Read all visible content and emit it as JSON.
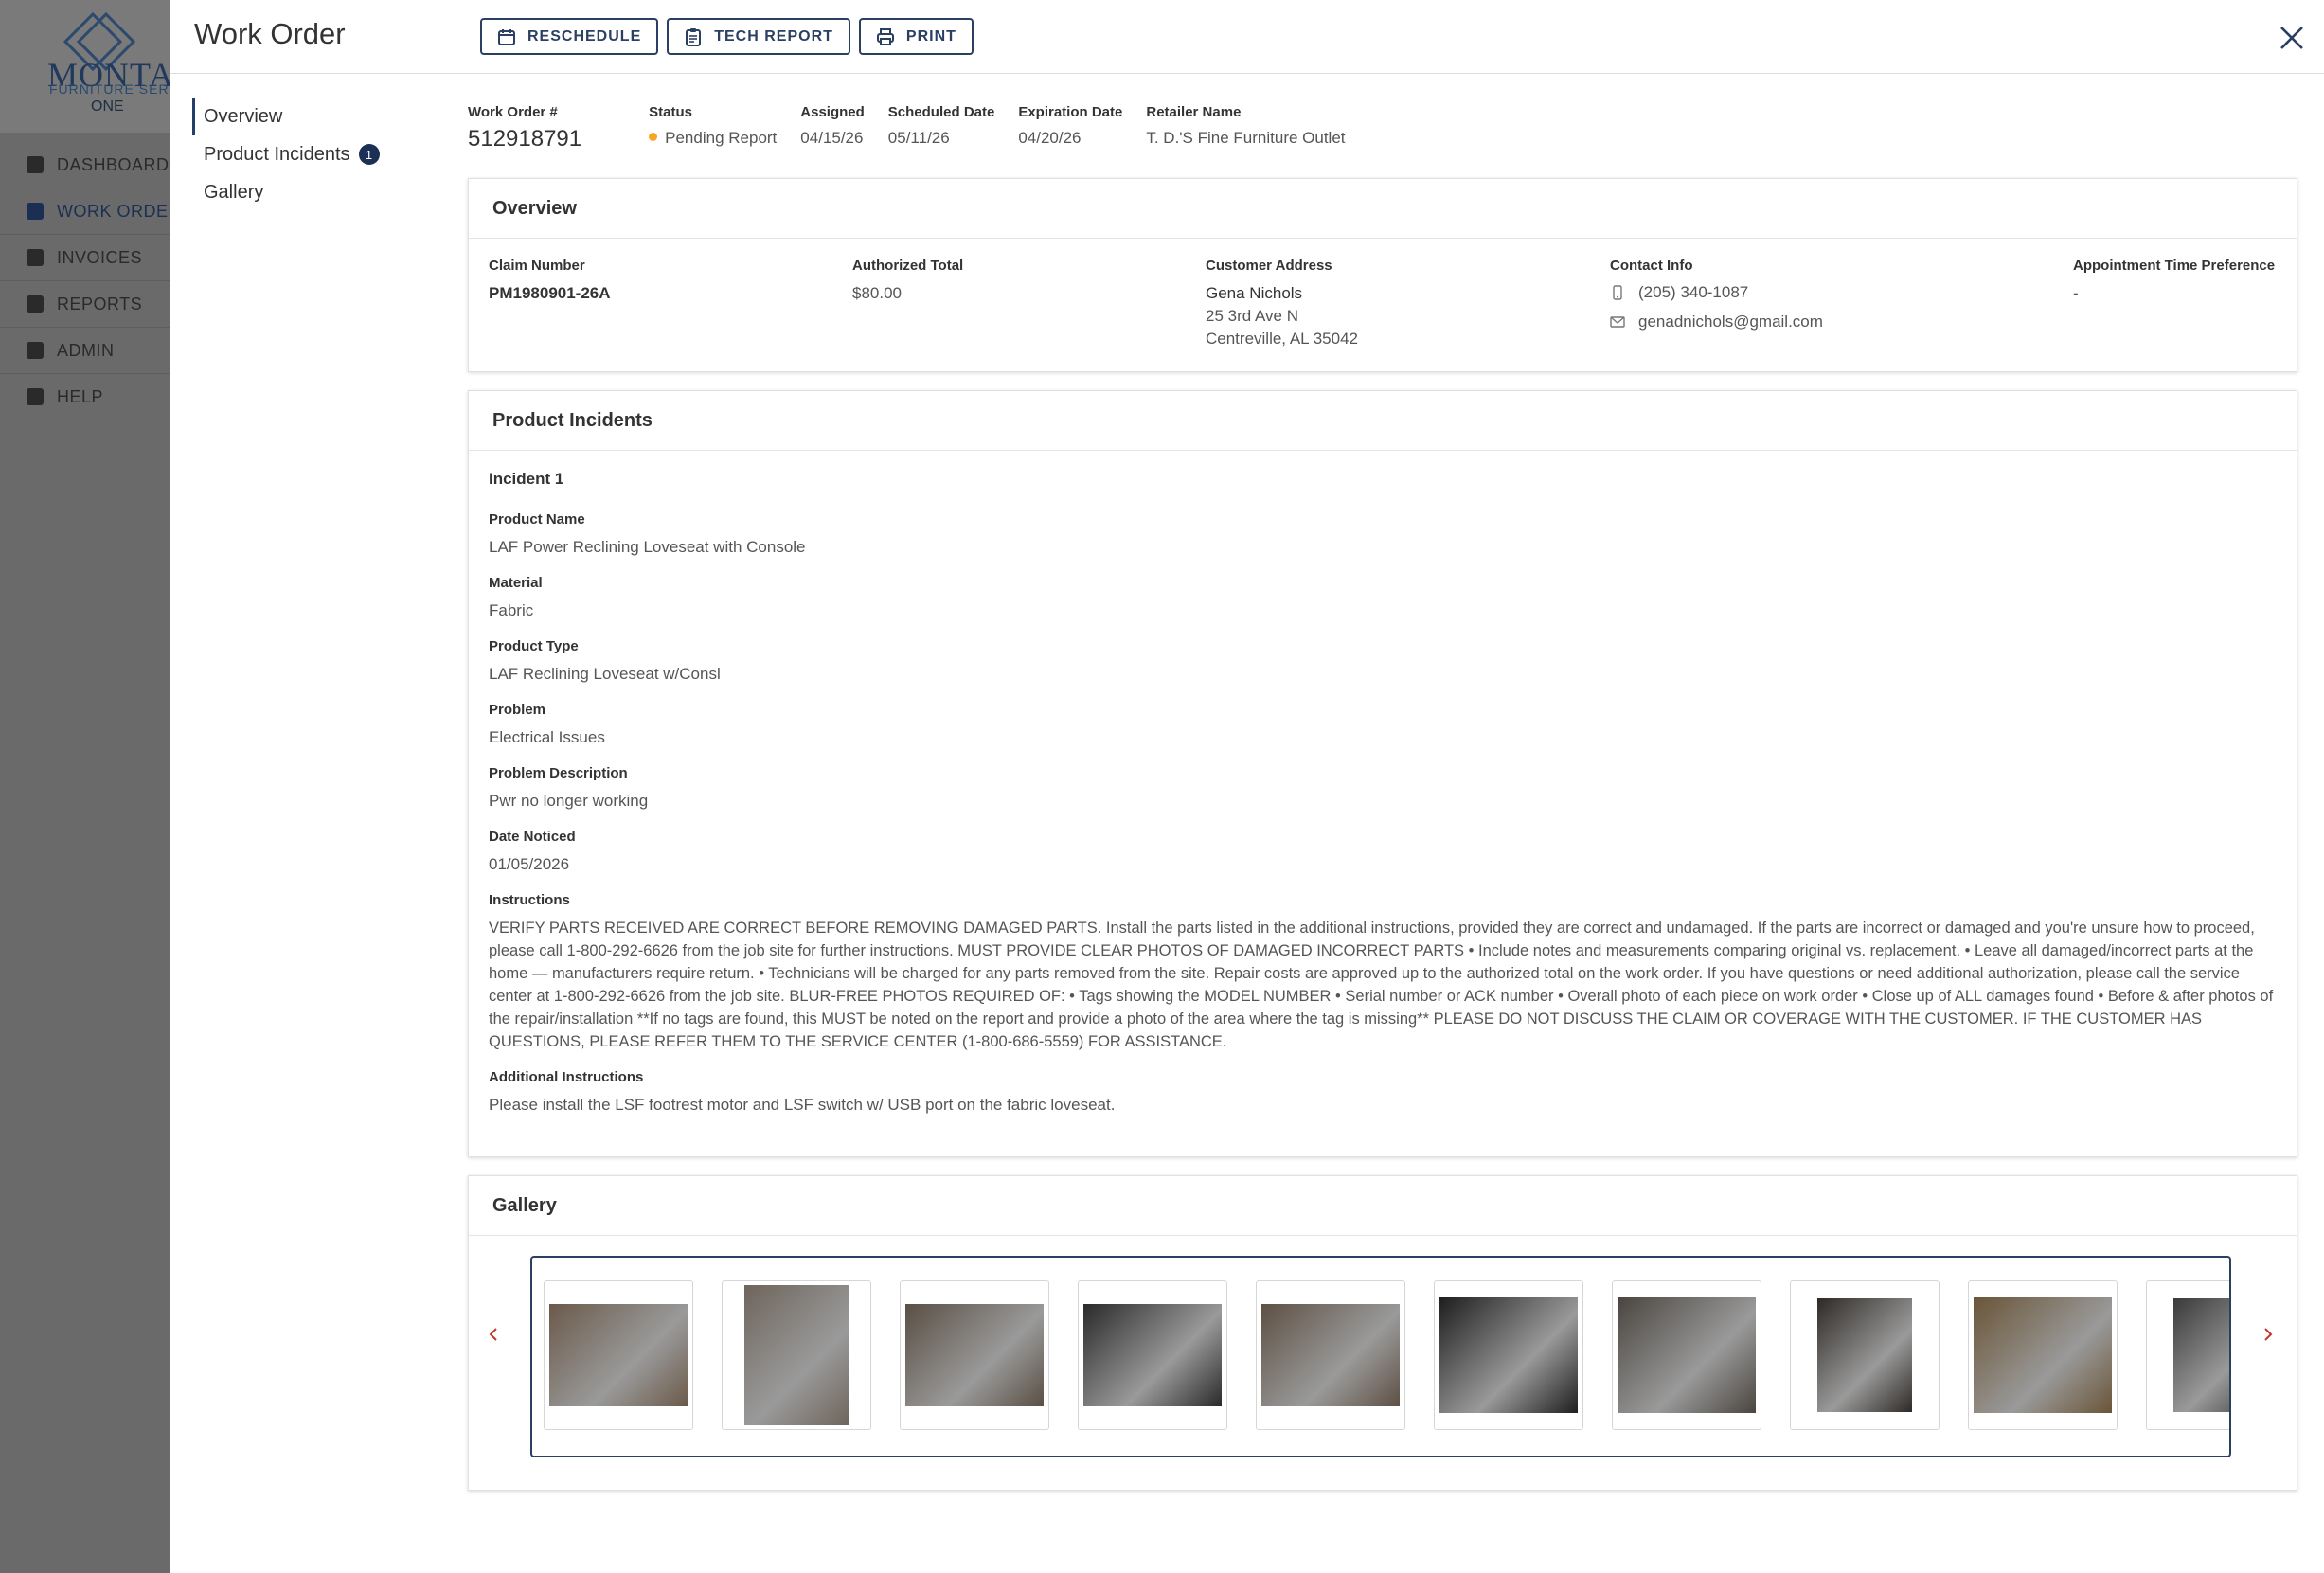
{
  "app": {
    "logo": {
      "name": "MONTAG",
      "sub": "FURNITURE SERV",
      "sub2": "ONE"
    },
    "nav": [
      {
        "label": "DASHBOARD"
      },
      {
        "label": "WORK ORDERS"
      },
      {
        "label": "INVOICES"
      },
      {
        "label": "REPORTS"
      },
      {
        "label": "ADMIN"
      },
      {
        "label": "HELP"
      }
    ]
  },
  "modal": {
    "title": "Work Order",
    "toolbar": {
      "reschedule": "RESCHEDULE",
      "tech_report": "TECH REPORT",
      "print": "PRINT"
    }
  },
  "section_nav": {
    "overview": "Overview",
    "product_incidents": "Product Incidents",
    "product_incidents_count": "1",
    "gallery": "Gallery"
  },
  "summary": {
    "work_order_label": "Work Order #",
    "work_order_value": "512918791",
    "status_label": "Status",
    "status_value": "Pending Report",
    "status_color": "#f5a623",
    "assigned_label": "Assigned",
    "assigned_value": "04/15/26",
    "scheduled_label": "Scheduled Date",
    "scheduled_value": "05/11/26",
    "expiration_label": "Expiration Date",
    "expiration_value": "04/20/26",
    "retailer_label": "Retailer Name",
    "retailer_value": "T. D.'S Fine Furniture Outlet"
  },
  "overview": {
    "heading": "Overview",
    "claim_label": "Claim Number",
    "claim_value": "PM1980901-26A",
    "total_label": "Authorized Total",
    "total_value": "$80.00",
    "address_label": "Customer Address",
    "customer_name": "Gena Nichols",
    "address_line1": "25 3rd Ave N",
    "address_line2": "Centreville, AL 35042",
    "contact_label": "Contact Info",
    "phone": "(205) 340-1087",
    "email": "genadnichols@gmail.com",
    "appt_label": "Appointment Time Preference",
    "appt_value": "-"
  },
  "incidents": {
    "heading": "Product Incidents",
    "incident_title": "Incident 1",
    "product_name_label": "Product Name",
    "product_name": "LAF Power Reclining Loveseat with Console",
    "material_label": "Material",
    "material": "Fabric",
    "product_type_label": "Product Type",
    "product_type": "LAF Reclining Loveseat w/Consl",
    "problem_label": "Problem",
    "problem": "Electrical Issues",
    "problem_desc_label": "Problem Description",
    "problem_desc": "Pwr no longer working",
    "date_noticed_label": "Date Noticed",
    "date_noticed": "01/05/2026",
    "instructions_label": "Instructions",
    "instructions": "VERIFY PARTS RECEIVED ARE CORRECT BEFORE REMOVING DAMAGED PARTS. Install the parts listed in the additional instructions, provided they are correct and undamaged. If the parts are incorrect or damaged and you're unsure how to proceed, please call 1-800-292-6626 from the job site for further instructions. MUST PROVIDE CLEAR PHOTOS OF DAMAGED INCORRECT PARTS • Include notes and measurements comparing original vs. replacement. • Leave all damaged/incorrect parts at the home — manufacturers require return. • Technicians will be charged for any parts removed from the site. Repair costs are approved up to the authorized total on the work order. If you have questions or need additional authorization, please call the service center at 1-800-292-6626 from the job site. BLUR-FREE PHOTOS REQUIRED OF: • Tags showing the MODEL NUMBER • Serial number or ACK number • Overall photo of each piece on work order • Close up of ALL damages found • Before & after photos of the repair/installation **If no tags are found, this MUST be noted on the report and provide a photo of the area where the tag is missing** PLEASE DO NOT DISCUSS THE CLAIM OR COVERAGE WITH THE CUSTOMER. IF THE CUSTOMER HAS QUESTIONS, PLEASE REFER THEM TO THE SERVICE CENTER (1-800-686-5559) FOR ASSISTANCE.",
    "additional_label": "Additional Instructions",
    "additional": "Please install the LSF footrest motor and LSF switch w/ USB port on the fabric loveseat."
  },
  "gallery": {
    "heading": "Gallery",
    "accent_color": "#c0392b",
    "photos": [
      {
        "subject": "living-room-sectional",
        "color": "#6b5a4a"
      },
      {
        "subject": "recliner-chair",
        "color": "#6e655c"
      },
      {
        "subject": "power-button-finger",
        "color": "#5a4f44"
      },
      {
        "subject": "product-label-tag",
        "color": "#2a2a2a"
      },
      {
        "subject": "loveseat-fabric",
        "color": "#5e5044"
      },
      {
        "subject": "paper-document",
        "color": "#1e1e1e"
      },
      {
        "subject": "motor-underside",
        "color": "#4a4540"
      },
      {
        "subject": "wiring-harness",
        "color": "#2e2a26"
      },
      {
        "subject": "usb-port-switch",
        "color": "#6a5538"
      },
      {
        "subject": "model-label",
        "color": "#3a3a3a"
      }
    ]
  }
}
